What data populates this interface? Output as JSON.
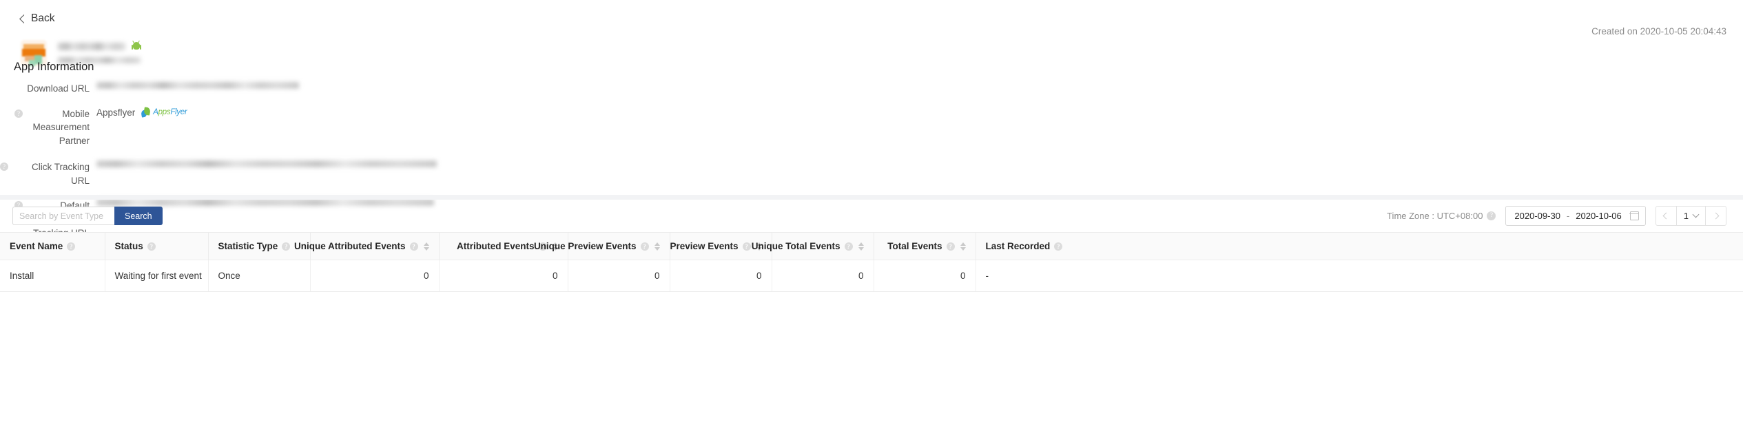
{
  "back": {
    "label": "Back",
    "icon": "chevron-left-icon"
  },
  "app_header": {
    "platform_icon": "android-icon",
    "name_redacted": "",
    "package_redacted": "",
    "created_on": "Created on 2020-10-05 20:04:43"
  },
  "app_information": {
    "title": "App Information",
    "rows": [
      {
        "label": "Download URL",
        "has_help": false,
        "type": "blurred-url",
        "value": ""
      },
      {
        "label": "Mobile Measurement Partner",
        "has_help": true,
        "type": "partner",
        "value": "Appsflyer",
        "logo": "appsflyer-logo"
      },
      {
        "label": "Click Tracking URL",
        "has_help": true,
        "type": "blurred-url",
        "value": ""
      },
      {
        "label": "Default Impression Tracking URL",
        "has_help": true,
        "type": "blurred-url",
        "value": ""
      }
    ]
  },
  "toolbar": {
    "search_placeholder": "Search by Event Type",
    "search_value": "",
    "search_button": "Search",
    "timezone_label": "Time Zone : UTC+08:00",
    "date_start": "2020-09-30",
    "date_separator": "-",
    "date_end": "2020-10-06",
    "calendar_icon": "calendar-icon",
    "page_number": "1",
    "prev_icon": "chevron-left-icon",
    "next_icon": "chevron-right-icon"
  },
  "table": {
    "columns": [
      {
        "label": "Event Name",
        "help": true,
        "sortable": false,
        "align": "left"
      },
      {
        "label": "Status",
        "help": true,
        "sortable": false,
        "align": "left"
      },
      {
        "label": "Statistic Type",
        "help": true,
        "sortable": false,
        "align": "left"
      },
      {
        "label": "Unique Attributed Events",
        "help": true,
        "sortable": true,
        "align": "right"
      },
      {
        "label": "Attributed Events",
        "help": true,
        "sortable": true,
        "align": "right"
      },
      {
        "label": "Unique Preview Events",
        "help": true,
        "sortable": true,
        "align": "right"
      },
      {
        "label": "Preview Events",
        "help": true,
        "sortable": true,
        "align": "right"
      },
      {
        "label": "Unique Total Events",
        "help": true,
        "sortable": true,
        "align": "right"
      },
      {
        "label": "Total Events",
        "help": true,
        "sortable": true,
        "align": "right"
      },
      {
        "label": "Last Recorded",
        "help": true,
        "sortable": false,
        "align": "left"
      }
    ],
    "rows": [
      {
        "event_name": "Install",
        "status": "Waiting for first event",
        "statistic_type": "Once",
        "unique_attributed_events": "0",
        "attributed_events": "0",
        "unique_preview_events": "0",
        "preview_events": "0",
        "unique_total_events": "0",
        "total_events": "0",
        "last_recorded": "-"
      }
    ]
  },
  "colors": {
    "accent": "#2e5597",
    "header_bg": "#fafafa",
    "border": "#ececec",
    "muted_text": "#8c8c8c",
    "android_green": "#8ec549",
    "appsflyer_green": "#7dc142",
    "appsflyer_blue": "#2e9bd8"
  }
}
